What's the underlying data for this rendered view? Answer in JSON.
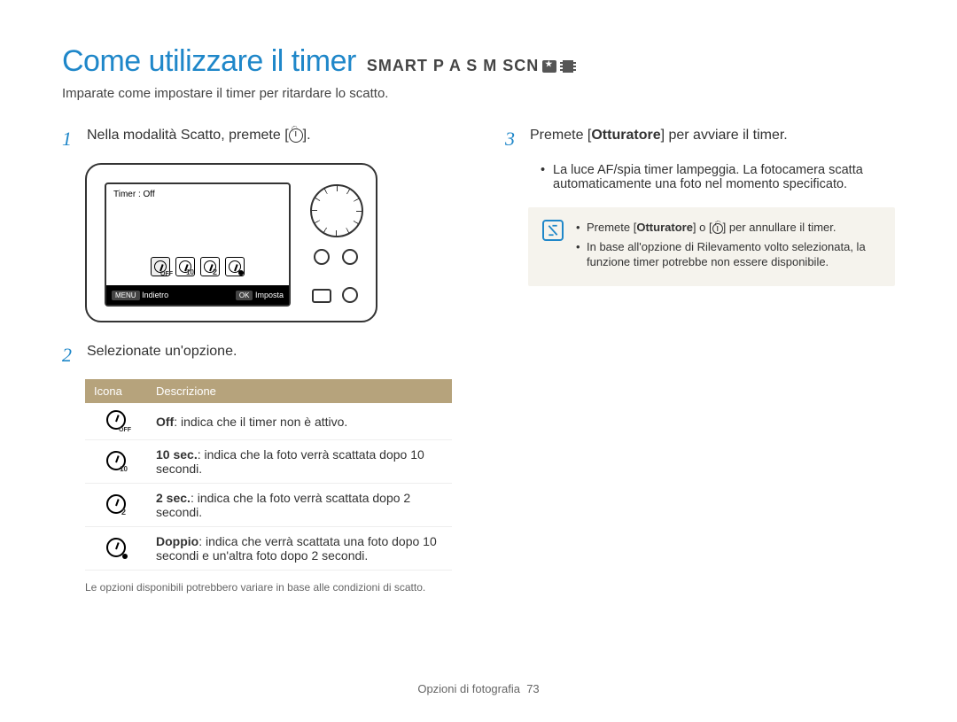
{
  "title": "Come utilizzare il timer",
  "modes": "SMART P A S M SCN",
  "subtitle": "Imparate come impostare il timer per ritardare lo scatto.",
  "left": {
    "step1_pre": "Nella modalità Scatto, premete [",
    "step1_post": "].",
    "camera_screen": {
      "top_label": "Timer : Off",
      "back_btn": "MENU",
      "back_label": "Indietro",
      "set_btn": "OK",
      "set_label": "Imposta"
    },
    "step2": "Selezionate un'opzione.",
    "table": {
      "head_icon": "Icona",
      "head_desc": "Descrizione",
      "rows": [
        {
          "bold": "Off",
          "rest": ": indica che il timer non è attivo."
        },
        {
          "bold": "10 sec.",
          "rest": ": indica che la foto verrà scattata dopo 10 secondi."
        },
        {
          "bold": "2 sec.",
          "rest": ": indica che la foto verrà scattata dopo 2 secondi."
        },
        {
          "bold": "Doppio",
          "rest": ": indica che verrà scattata una foto dopo 10 secondi e un'altra foto dopo 2 secondi."
        }
      ]
    },
    "footnote": "Le opzioni disponibili potrebbero variare in base alle condizioni di scatto."
  },
  "right": {
    "step3_pre": "Premete [",
    "step3_bold": "Otturatore",
    "step3_post": "] per avviare il timer.",
    "bullet1": "La luce AF/spia timer lampeggia. La fotocamera scatta automaticamente una foto nel momento specificato.",
    "note1_pre": "Premete [",
    "note1_bold": "Otturatore",
    "note1_mid": "] o [",
    "note1_post": "] per annullare il timer.",
    "note2": "In base all'opzione di Rilevamento volto selezionata, la funzione timer potrebbe non essere disponibile."
  },
  "footer": {
    "section": "Opzioni di fotografia",
    "page": "73"
  }
}
